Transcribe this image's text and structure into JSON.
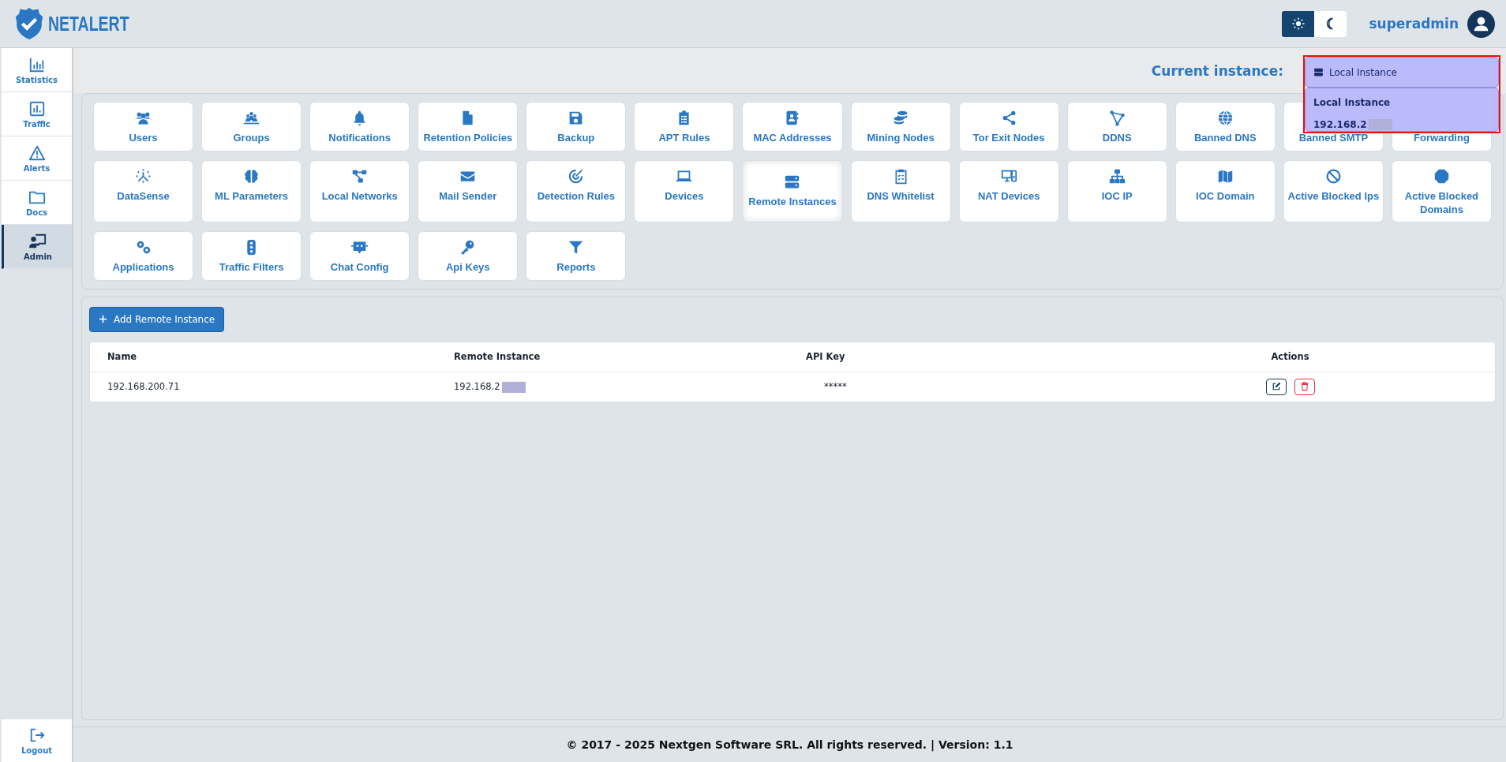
{
  "brand": {
    "name": "NETALERT"
  },
  "theme_toggle": [
    {
      "kind": "light",
      "selected": true
    },
    {
      "kind": "dark",
      "selected": false
    }
  ],
  "user": {
    "name": "superadmin"
  },
  "sidebar": {
    "items": [
      {
        "label": "Statistics",
        "selected": false
      },
      {
        "label": "Traffic",
        "selected": false
      },
      {
        "label": "Alerts",
        "selected": false
      },
      {
        "label": "Docs",
        "selected": false
      },
      {
        "label": "Admin",
        "selected": true
      }
    ],
    "logout": "Logout"
  },
  "instance_selector": {
    "label": "Current instance:",
    "value": "Local Instance",
    "highlighted": true,
    "options": [
      {
        "label": "Local Instance",
        "redacted": false
      },
      {
        "label": "192.168.2",
        "redacted": true
      }
    ]
  },
  "admin_tiles": [
    {
      "label": "Users",
      "selected": false
    },
    {
      "label": "Groups",
      "selected": false
    },
    {
      "label": "Notifications",
      "selected": false
    },
    {
      "label": "Retention Policies",
      "selected": false
    },
    {
      "label": "Backup",
      "selected": false
    },
    {
      "label": "APT Rules",
      "selected": false
    },
    {
      "label": "MAC Addresses",
      "selected": false
    },
    {
      "label": "Mining Nodes",
      "selected": false
    },
    {
      "label": "Tor Exit Nodes",
      "selected": false
    },
    {
      "label": "DDNS",
      "selected": false
    },
    {
      "label": "Banned DNS",
      "selected": false
    },
    {
      "label": "Banned SMTP",
      "selected": false
    },
    {
      "label": "Forwarding",
      "selected": false
    },
    {
      "label": "DataSense",
      "selected": false
    },
    {
      "label": "ML Parameters",
      "selected": false
    },
    {
      "label": "Local Networks",
      "selected": false
    },
    {
      "label": "Mail Sender",
      "selected": false
    },
    {
      "label": "Detection Rules",
      "selected": false
    },
    {
      "label": "Devices",
      "selected": false
    },
    {
      "label": "Remote Instances",
      "selected": true
    },
    {
      "label": "DNS Whitelist",
      "selected": false
    },
    {
      "label": "NAT Devices",
      "selected": false
    },
    {
      "label": "IOC IP",
      "selected": false
    },
    {
      "label": "IOC Domain",
      "selected": false
    },
    {
      "label": "Active Blocked Ips",
      "selected": false
    },
    {
      "label": "Active Blocked Domains",
      "selected": false
    },
    {
      "label": "Applications",
      "selected": false
    },
    {
      "label": "Traffic Filters",
      "selected": false
    },
    {
      "label": "Chat Config",
      "selected": false
    },
    {
      "label": "Api Keys",
      "selected": false
    },
    {
      "label": "Reports",
      "selected": false
    }
  ],
  "add_button": {
    "label": "Add Remote Instance"
  },
  "table": {
    "columns": [
      "Name",
      "Remote Instance",
      "API Key",
      "Actions"
    ],
    "rows": [
      {
        "name": "192.168.200.71",
        "remote_instance": {
          "text": "192.168.2",
          "redacted": true
        },
        "api_key": "*****"
      }
    ]
  },
  "footer": "© 2017 - 2025 Nextgen Software SRL. All rights reserved. | Version: 1.1"
}
